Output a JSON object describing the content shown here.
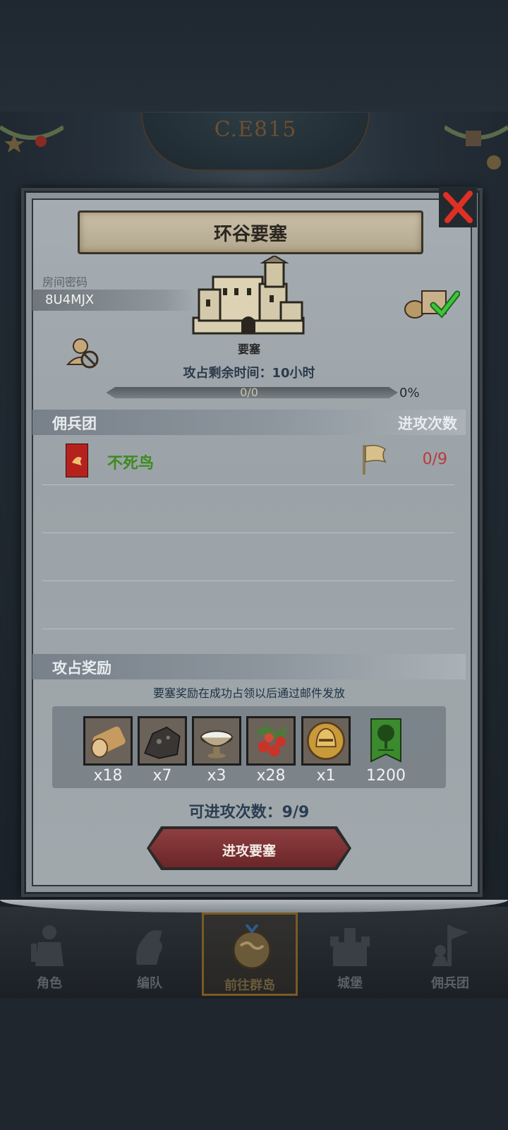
{
  "era": "C.E815",
  "dialog": {
    "title": "环谷要塞",
    "room_code_label": "房间密码",
    "room_code": "8U4MJX",
    "building_label": "要塞",
    "time_left": "攻占剩余时间：10小时",
    "progress_text": "0/0",
    "progress_percent": "0%",
    "progress_fraction": 0
  },
  "mercenary_section": {
    "title": "佣兵团",
    "attack_count_header": "进攻次数",
    "rows": [
      {
        "name": "不死鸟",
        "attack_count": "0/9"
      }
    ]
  },
  "reward_section": {
    "title": "攻占奖励",
    "note": "要塞奖励在成功占领以后通过邮件发放",
    "items": [
      {
        "icon": "wood-log-icon",
        "qty": "x18"
      },
      {
        "icon": "coal-ore-icon",
        "qty": "x7"
      },
      {
        "icon": "silver-bowl-icon",
        "qty": "x3"
      },
      {
        "icon": "berries-icon",
        "qty": "x28"
      },
      {
        "icon": "gold-helmet-coin-icon",
        "qty": "x1"
      },
      {
        "icon": "green-tree-banner-icon",
        "qty": "1200"
      }
    ]
  },
  "attempts_text": "可进攻次数：9/9",
  "attack_button": "进攻要塞",
  "nav": [
    {
      "label": "角色",
      "icon": "warrior-icon"
    },
    {
      "label": "编队",
      "icon": "knight-horse-icon"
    },
    {
      "label": "前往群岛",
      "icon": "globe-islands-icon"
    },
    {
      "label": "城堡",
      "icon": "castle-icon"
    },
    {
      "label": "佣兵团",
      "icon": "mercenary-icon"
    }
  ],
  "colors": {
    "merc_name": "#3e8a1f",
    "attack_count": "#b83a3a",
    "button": "#7b3133"
  }
}
